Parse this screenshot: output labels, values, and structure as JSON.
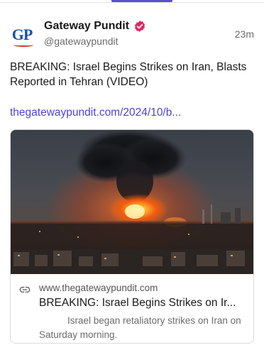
{
  "post": {
    "author": {
      "name": "Gateway Pundit",
      "handle": "@gatewaypundit",
      "avatar_text": "GP",
      "verified": true
    },
    "timestamp": "23m",
    "text": "BREAKING: Israel Begins Strikes on Iran, Blasts Reported in Tehran (VIDEO)",
    "link": "thegatewaypundit.com/2024/10/b...",
    "card": {
      "domain": "www.thegatewaypundit.com",
      "title": "BREAKING: Israel Begins Strikes on Ir...",
      "description": "Israel began retaliatory strikes on Iran on Saturday morning."
    }
  },
  "colors": {
    "accent": "#5a4fd6",
    "link": "#4b45d1",
    "verified_badge": "#e0245e",
    "logo_blue": "#1d4fa3",
    "logo_red": "#d6312b"
  },
  "icons": {
    "verified": "verified-badge-icon",
    "link": "link-icon"
  }
}
